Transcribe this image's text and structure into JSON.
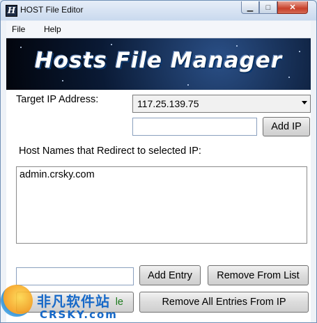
{
  "window": {
    "title": "HOST File Editor",
    "app_icon": "H"
  },
  "menu": {
    "items": [
      {
        "label": "File"
      },
      {
        "label": "Help"
      }
    ]
  },
  "banner": {
    "text": "Hosts File Manager"
  },
  "target_ip": {
    "label": "Target IP Address:",
    "selected": "117.25.139.75"
  },
  "add_ip": {
    "input_value": "",
    "button_label": "Add IP"
  },
  "hosts": {
    "label": "Host Names that Redirect to selected IP:",
    "items": [
      "admin.crsky.com"
    ]
  },
  "entry": {
    "input_value": "",
    "add_label": "Add Entry",
    "remove_label": "Remove From List"
  },
  "bottom": {
    "partial_button_tail": "le",
    "remove_all_label": "Remove All Entries From IP"
  },
  "watermark": {
    "cn": "非凡软件站",
    "en": "CRSKY.com"
  },
  "colors": {
    "watermark_blue": "#1769c8",
    "close_red": "#c7402a"
  },
  "icons": {
    "minimize": "minimize-icon",
    "maximize": "maximize-icon",
    "close": "close-icon",
    "dropdown": "chevron-down-icon"
  }
}
